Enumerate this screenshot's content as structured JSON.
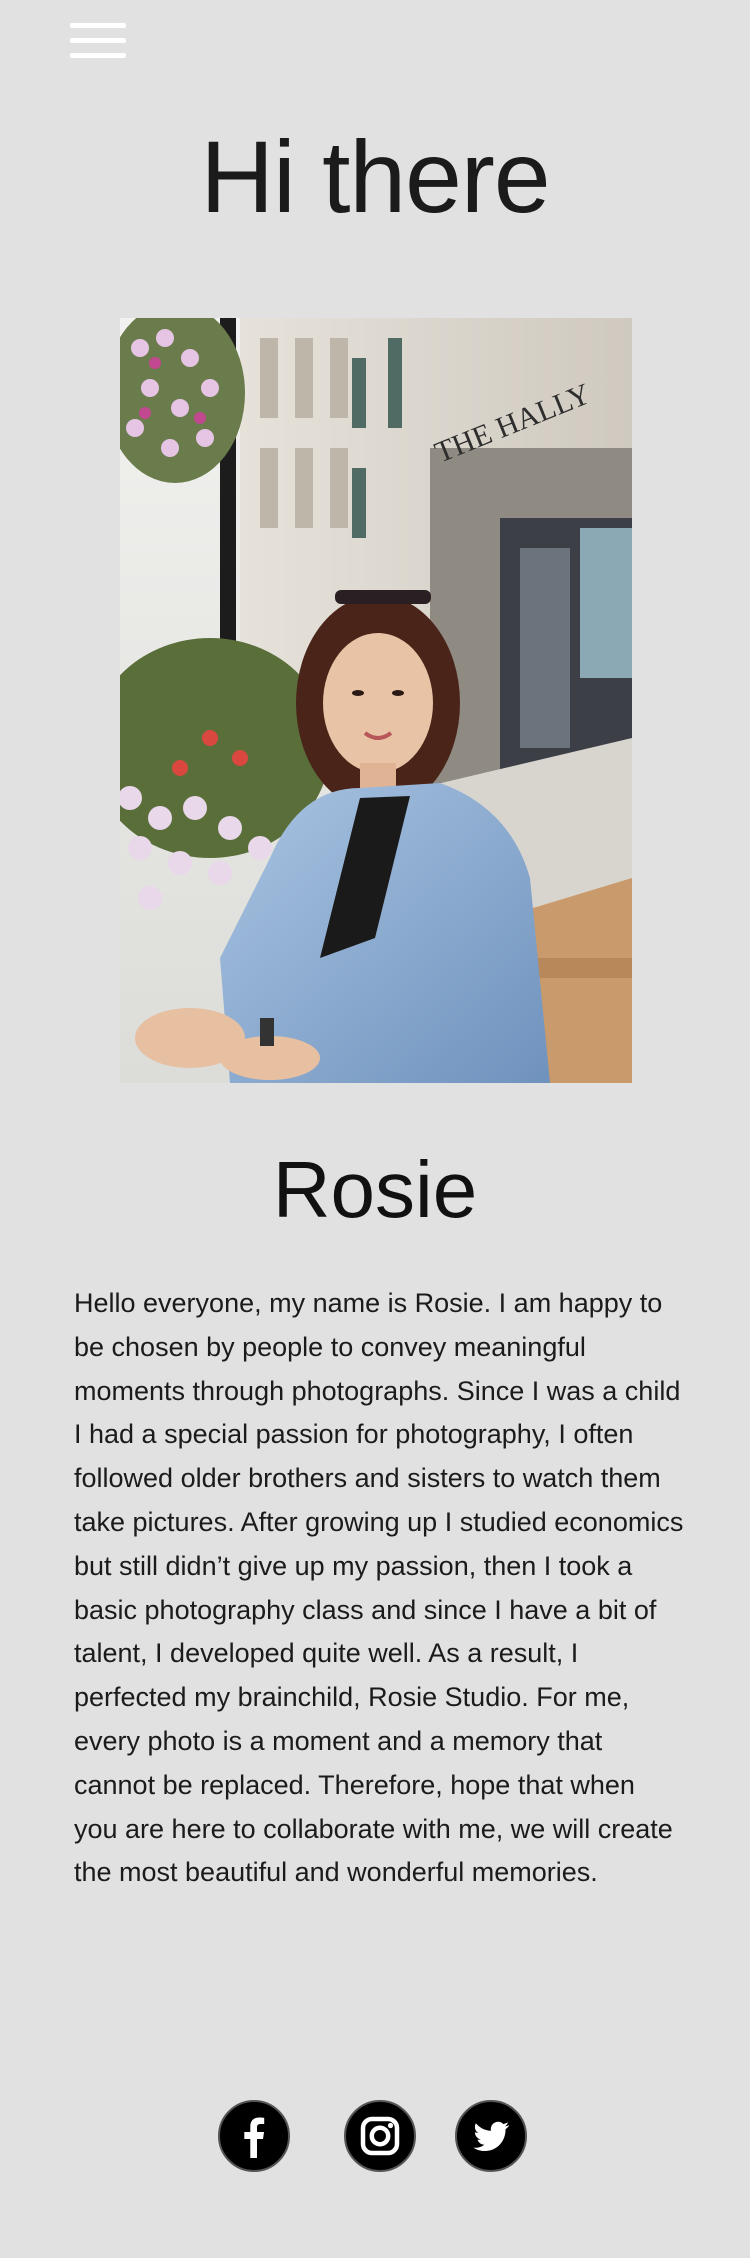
{
  "header": {
    "menu_icon": "hamburger-menu-icon",
    "greeting": "Hi there"
  },
  "profile": {
    "photo_alt": "Portrait of Rosie sitting on a bench in a denim jacket",
    "name": "Rosie",
    "bio": "Hello everyone, my name is Rosie. I am happy to be chosen by people to convey meaningful moments through photographs. Since I was a child I had a special passion for photography, I often followed older brothers and sisters to watch them take pictures. After growing up I studied economics but still didn’t give up my passion, then I took a basic photography class and since I have a bit of talent, I developed quite well. As a result, I perfected my brainchild, Rosie Studio. For me, every photo is a moment and a memory that cannot be replaced. Therefore, hope that when you are here to collaborate with me, we will create the most beautiful and wonderful memories."
  },
  "social": [
    {
      "icon": "facebook-icon"
    },
    {
      "icon": "instagram-icon"
    },
    {
      "icon": "twitter-icon"
    }
  ],
  "colors": {
    "background": "#e1e1e1",
    "text": "#111111",
    "icon_fill": "#000000"
  }
}
